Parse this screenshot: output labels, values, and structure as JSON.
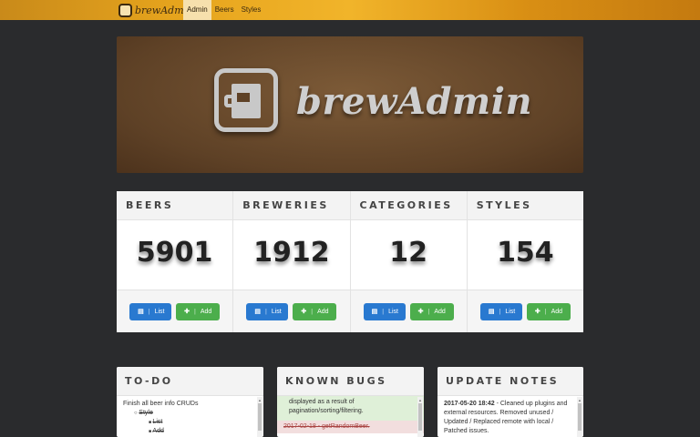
{
  "nav": {
    "brand": "brewAdmin",
    "items": [
      {
        "label": "Admin",
        "active": true
      },
      {
        "label": "Beers",
        "active": false
      },
      {
        "label": "Styles",
        "active": false
      }
    ]
  },
  "hero": {
    "title": "brewAdmin"
  },
  "stats": [
    {
      "title": "BEERS",
      "value": "5901",
      "list_label": "List",
      "add_label": "Add"
    },
    {
      "title": "BREWERIES",
      "value": "1912",
      "list_label": "List",
      "add_label": "Add"
    },
    {
      "title": "CATEGORIES",
      "value": "12",
      "list_label": "List",
      "add_label": "Add"
    },
    {
      "title": "STYLES",
      "value": "154",
      "list_label": "List",
      "add_label": "Add"
    }
  ],
  "todo": {
    "title": "TO-DO",
    "line1": "Finish all beer info CRUDs",
    "line2": "Style",
    "line3": "List",
    "line4": "Add"
  },
  "bugs": {
    "title": "KNOWN BUGS",
    "ok_text": "displayed as a result of pagination/sorting/filtering.",
    "bad_text": "2017-02-18 - getRandomBeer."
  },
  "notes": {
    "title": "UPDATE NOTES",
    "date": "2017-05-20 18:42",
    "text": " - Cleaned up plugins and external resources. Removed unused / Updated / Replaced remote with local / Patched issues."
  },
  "colors": {
    "nav_bar": "#e6a41d",
    "background": "#2a2b2d",
    "list_button": "#2979d0",
    "add_button": "#4cae4c"
  }
}
